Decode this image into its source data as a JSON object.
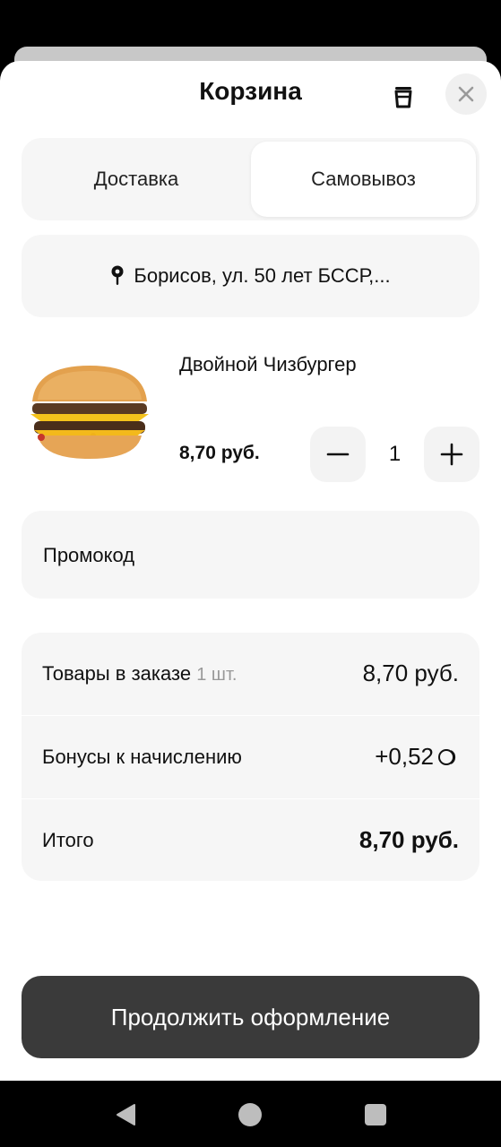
{
  "header": {
    "title": "Корзина"
  },
  "delivery_toggle": {
    "delivery_label": "Доставка",
    "pickup_label": "Самовывоз",
    "selected": "Самовывоз"
  },
  "address": {
    "text": "Борисов, ул. 50 лет БССР,..."
  },
  "cart_item": {
    "name": "Двойной Чизбургер",
    "price": "8,70 руб.",
    "quantity": "1"
  },
  "promo": {
    "label": "Промокод"
  },
  "summary": {
    "items_label": "Товары в заказе",
    "items_count": "1 шт.",
    "items_total": "8,70 руб.",
    "bonus_label": "Бонусы к начислению",
    "bonus_value": "+0,52",
    "total_label": "Итого",
    "total_value": "8,70 руб."
  },
  "cta": {
    "label": "Продолжить оформление"
  },
  "icons": [
    "trash-icon",
    "close-icon",
    "location-pin-icon",
    "minus-icon",
    "plus-icon",
    "bonus-coin-icon",
    "nav-back-icon",
    "nav-home-icon",
    "nav-recent-icon"
  ],
  "colors": {
    "cta_bg": "#3a3a3a",
    "card_bg": "#f6f6f6"
  }
}
